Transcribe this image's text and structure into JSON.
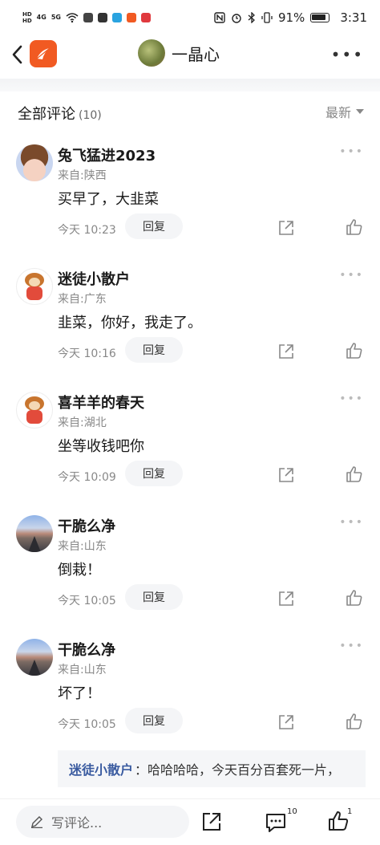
{
  "status_bar": {
    "left_signal_1": "HD",
    "left_signal_2": "4G",
    "left_signal_3": "5G",
    "battery": "91%",
    "time": "3:31"
  },
  "nav": {
    "title": "一晶心"
  },
  "comments_header": {
    "title": "全部评论",
    "count": "(10)",
    "sort": "最新"
  },
  "comments": [
    {
      "name": "兔飞猛进2023",
      "origin": "来自:陕西",
      "text": "买早了，大韭菜",
      "time": "今天 10:23",
      "reply": "回复",
      "avatar": "anime"
    },
    {
      "name": "迷徒小散户",
      "origin": "来自:广东",
      "text": "韭菜，你好，我走了。",
      "time": "今天 10:16",
      "reply": "回复",
      "avatar": "monkey"
    },
    {
      "name": "喜羊羊的春天",
      "origin": "来自:湖北",
      "text": "坐等收钱吧你",
      "time": "今天 10:09",
      "reply": "回复",
      "avatar": "monkey"
    },
    {
      "name": "干脆么净",
      "origin": "来自:山东",
      "text": "倒栽！",
      "time": "今天 10:05",
      "reply": "回复",
      "avatar": "road"
    },
    {
      "name": "干脆么净",
      "origin": "来自:山东",
      "text": "坏了！",
      "time": "今天 10:05",
      "reply": "回复",
      "avatar": "road"
    }
  ],
  "quote": {
    "name": "迷徒小散户",
    "text": "：哈哈哈哈，今天百分百套死一片，"
  },
  "bottom_bar": {
    "placeholder": "写评论...",
    "comment_count": "10",
    "like_count": "1"
  },
  "colors": {
    "brand": "#f15a22",
    "quote_name": "#3a5ba0"
  }
}
